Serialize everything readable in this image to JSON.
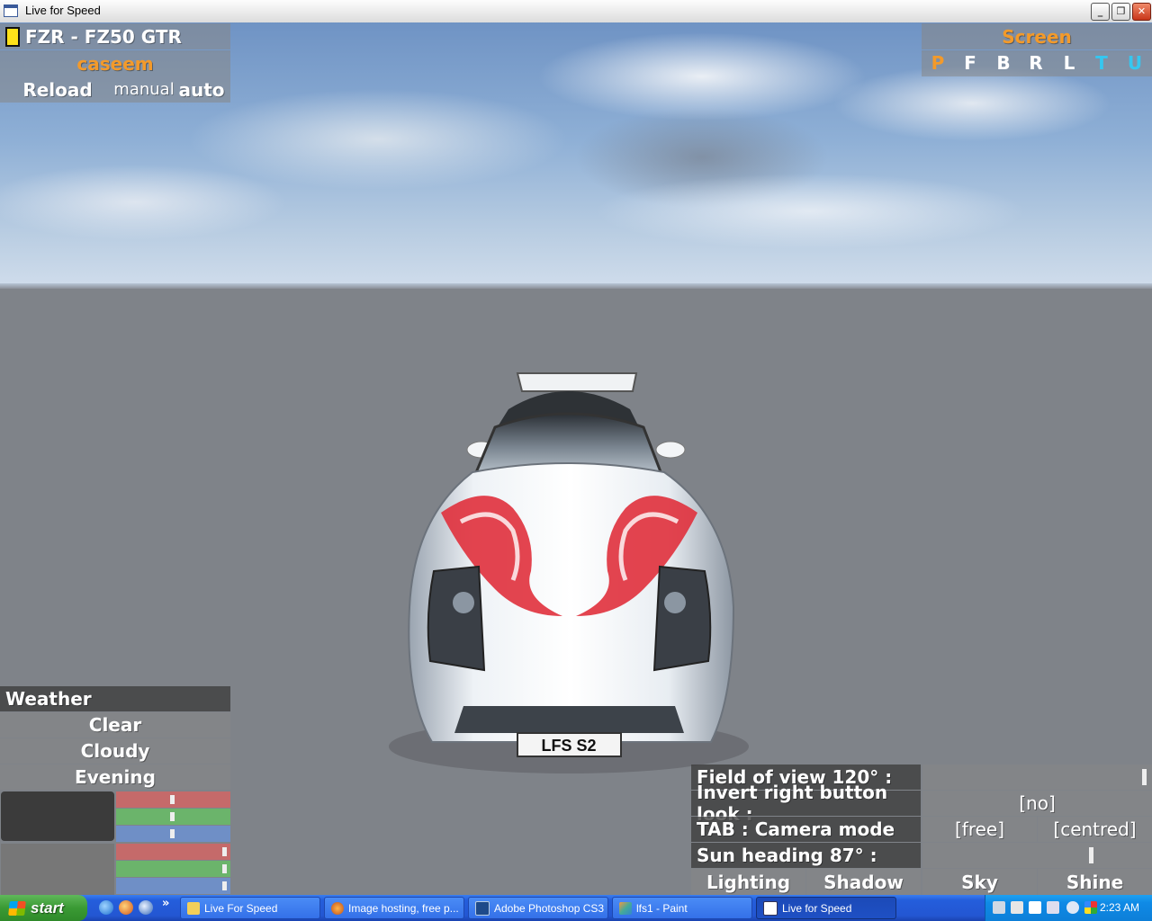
{
  "window": {
    "title": "Live for Speed"
  },
  "car_panel": {
    "car_name": "FZR - FZ50 GTR",
    "skin": "caseem",
    "reload_label": "Reload",
    "manual_label": "manual",
    "auto_label": "auto"
  },
  "screen_panel": {
    "title": "Screen",
    "views": [
      {
        "label": "P",
        "color": "#f39a2a"
      },
      {
        "label": "F",
        "color": "#ffffff"
      },
      {
        "label": "B",
        "color": "#ffffff"
      },
      {
        "label": "R",
        "color": "#ffffff"
      },
      {
        "label": "L",
        "color": "#ffffff"
      },
      {
        "label": "T",
        "color": "#35c7f0"
      },
      {
        "label": "U",
        "color": "#35c7f0"
      }
    ]
  },
  "weather": {
    "title": "Weather",
    "options": [
      "Clear",
      "Cloudy",
      "Evening"
    ]
  },
  "camera_settings": {
    "fov_label": "Field of view 120° :",
    "invert_label": "Invert right button look :",
    "invert_value": "[no]",
    "tab_label": "TAB : Camera mode",
    "mode_free": "[free]",
    "mode_centred": "[centred]",
    "sun_label": "Sun heading 87° :",
    "tabs": [
      "Lighting",
      "Shadow",
      "Sky",
      "Shine"
    ]
  },
  "car": {
    "plate": "LFS S2"
  },
  "taskbar": {
    "start_label": "start",
    "items": [
      "Live For Speed",
      "Image hosting, free p...",
      "Adobe Photoshop CS3",
      "lfs1 - Paint",
      "Live for Speed"
    ],
    "overflow": "»",
    "clock": "2:23 AM"
  },
  "colors": {
    "accent_orange": "#f39a2a",
    "accent_cyan": "#35c7f0",
    "slider_red": "#c56a6a",
    "slider_green": "#6bb46b",
    "slider_blue": "#6f8fc6"
  }
}
